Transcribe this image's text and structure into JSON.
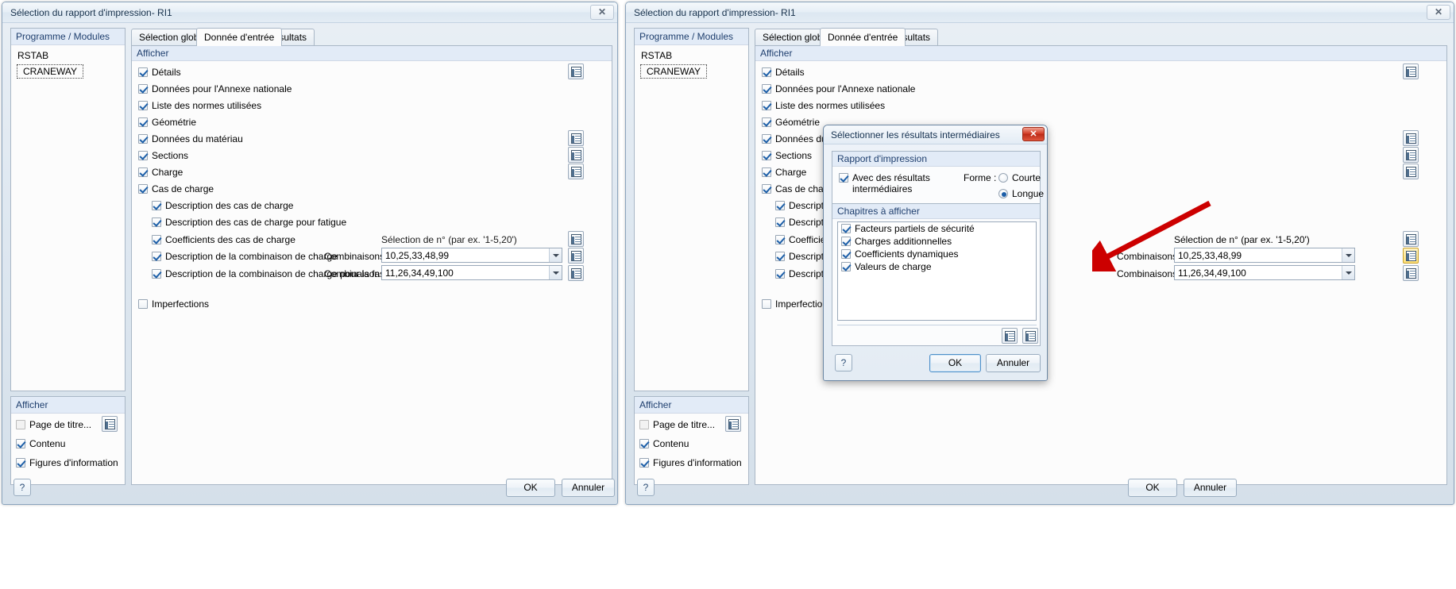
{
  "windows": [
    {
      "title": "Sélection du rapport d'impression- RI1",
      "close_label": "✕"
    },
    {
      "title": "Sélection du rapport d'impression- RI1",
      "close_label": "✕"
    }
  ],
  "left_panel": {
    "header": "Programme / Modules",
    "items": [
      "RSTAB",
      "CRANEWAY"
    ],
    "selected": "CRANEWAY"
  },
  "bottom_panel": {
    "header": "Afficher",
    "items": [
      {
        "label": "Page de titre...",
        "checked": false,
        "has_button": true
      },
      {
        "label": "Contenu",
        "checked": true,
        "has_button": false
      },
      {
        "label": "Figures d'information",
        "checked": true,
        "has_button": false
      }
    ]
  },
  "tabs": [
    {
      "label": "Sélection globale",
      "active": false
    },
    {
      "label": "Donnée d'entrée",
      "active": true
    },
    {
      "label": "Résultats",
      "active": false
    }
  ],
  "afficher": {
    "header": "Afficher",
    "items": [
      {
        "label": "Détails",
        "checked": true,
        "indent": 0,
        "button": true
      },
      {
        "label": "Données pour l'Annexe nationale",
        "checked": true,
        "indent": 0,
        "button": false
      },
      {
        "label": "Liste des normes utilisées",
        "checked": true,
        "indent": 0,
        "button": false
      },
      {
        "label": "Géométrie",
        "checked": true,
        "indent": 0,
        "button": false
      },
      {
        "label": "Données du matériau",
        "checked": true,
        "indent": 0,
        "button": true
      },
      {
        "label": "Sections",
        "checked": true,
        "indent": 0,
        "button": true
      },
      {
        "label": "Charge",
        "checked": true,
        "indent": 0,
        "button": true
      },
      {
        "label": "Cas de charge",
        "checked": true,
        "indent": 0,
        "button": false
      },
      {
        "label": "Description des cas de charge",
        "checked": true,
        "indent": 1,
        "button": false
      },
      {
        "label": "Description des cas de charge pour fatigue",
        "checked": true,
        "indent": 1,
        "button": false
      },
      {
        "label": "Coefficients des cas de charge",
        "checked": true,
        "indent": 1,
        "button": true
      },
      {
        "label": "Description de la combinaison de charge",
        "checked": true,
        "indent": 1,
        "button": true
      },
      {
        "label": "Description de la combinaison de charge pour la fa",
        "checked": true,
        "indent": 1,
        "button": true
      },
      {
        "label": "Imperfections",
        "checked": false,
        "indent": 0,
        "button": false
      }
    ]
  },
  "selection_hint": "Sélection de n° (par ex. '1-5,20')",
  "combinations": [
    {
      "label": "Combinaisons :",
      "value": "10,25,33,48,99"
    },
    {
      "label": "Combinaisons :",
      "value": "11,26,34,49,100"
    }
  ],
  "footer": {
    "help": "?",
    "ok": "OK",
    "cancel": "Annuler"
  },
  "modal": {
    "title": "Sélectionner les résultats intermédiaires",
    "close_label": "✕",
    "group_report": {
      "header": "Rapport d'impression",
      "checkbox": {
        "label_line1": "Avec des résultats",
        "label_line2": "intermédiaires",
        "checked": true
      },
      "forme_label": "Forme :",
      "options": [
        {
          "label": "Courte",
          "selected": false
        },
        {
          "label": "Longue",
          "selected": true
        }
      ]
    },
    "group_chapters": {
      "header": "Chapitres à afficher",
      "items": [
        {
          "label": "Facteurs partiels de sécurité",
          "checked": true
        },
        {
          "label": "Charges additionnelles",
          "checked": true
        },
        {
          "label": "Coefficients dynamiques",
          "checked": true
        },
        {
          "label": "Valeurs de charge",
          "checked": true
        }
      ],
      "tool_buttons": [
        "check-all-icon",
        "uncheck-all-icon"
      ]
    },
    "buttons": {
      "help": "?",
      "ok": "OK",
      "cancel": "Annuler"
    }
  },
  "colors": {
    "group_header_bg": "#e2ebf7",
    "group_header_text": "#1f3f6e",
    "annotation_arrow": "#cc0000",
    "highlight": "#ffe27a"
  }
}
